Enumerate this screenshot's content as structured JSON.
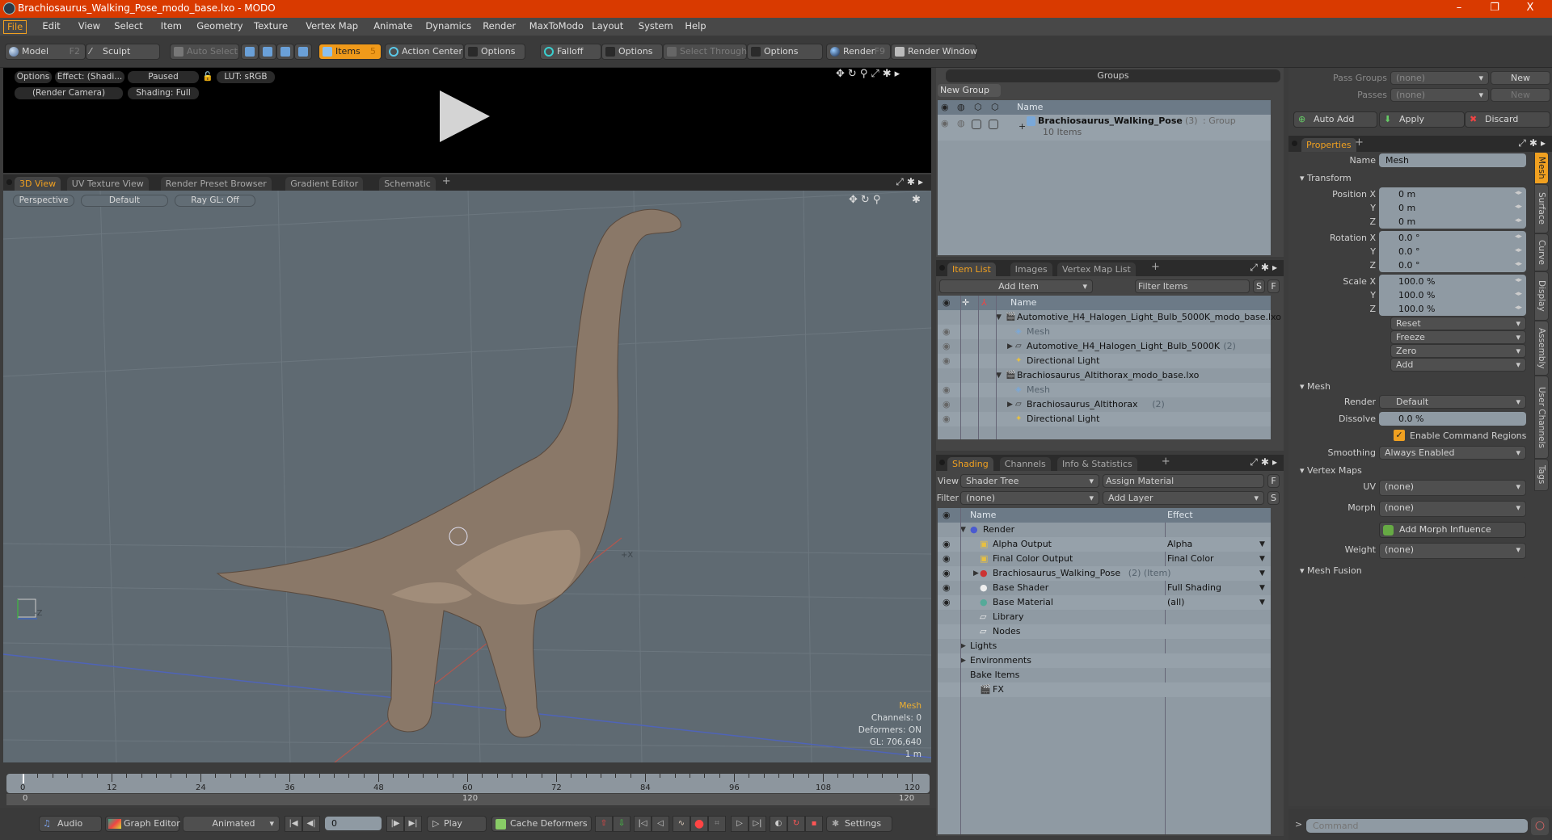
{
  "window": {
    "title": "Brachiosaurus_Walking_Pose_modo_base.lxo - MODO",
    "minimize": "–",
    "restore": "❐",
    "close": "X"
  },
  "menu": [
    "File",
    "Edit",
    "View",
    "Select",
    "Item",
    "Geometry",
    "Texture",
    "Vertex Map",
    "Animate",
    "Dynamics",
    "Render",
    "MaxToModo",
    "Layout",
    "System",
    "Help"
  ],
  "toolbar": {
    "model": "Model",
    "model_key": "F2",
    "sculpt": "Sculpt",
    "auto_select": "Auto Select",
    "items": "Items",
    "items_key": "5",
    "action_center": "Action Center",
    "options1": "Options",
    "falloff": "Falloff",
    "options2": "Options",
    "select_through": "Select Through",
    "options3": "Options",
    "render": "Render",
    "render_key": "F9",
    "render_window": "Render Window"
  },
  "preview": {
    "options": "Options",
    "effect": "Effect: (Shadi...",
    "paused": "Paused",
    "lut": "LUT: sRGB",
    "camera": "(Render Camera)",
    "shading": "Shading: Full"
  },
  "view_tabs": [
    "3D View",
    "UV Texture View",
    "Render Preset Browser",
    "Gradient Editor",
    "Schematic"
  ],
  "viewport": {
    "projection": "Perspective",
    "style": "Default",
    "raygl": "Ray GL: Off",
    "axis_neg_z": "-Z",
    "axis_pos_x": "+X",
    "stats": {
      "selection": "Mesh",
      "channels": "Channels: 0",
      "deformers": "Deformers: ON",
      "gl": "GL: 706,640",
      "scale": "1 m"
    },
    "accent": "#f0b030"
  },
  "timeline": {
    "ticks": [
      0,
      12,
      24,
      36,
      48,
      60,
      72,
      84,
      96,
      108,
      120
    ],
    "range_start": "0",
    "range_mid": "120",
    "range_end": "120"
  },
  "bottombar": {
    "audio": "Audio",
    "graph_editor": "Graph Editor",
    "animated": "Animated",
    "frame": "0",
    "play": "Play",
    "cache_deformers": "Cache Deformers",
    "settings": "Settings"
  },
  "groups": {
    "title": "Groups",
    "new_group": "New Group",
    "col_name": "Name",
    "item_name": "Brachiosaurus_Walking_Pose",
    "item_count": "(3)",
    "item_type": ": Group",
    "item_sub": "10 Items"
  },
  "itemlist": {
    "tabs": [
      "Item List",
      "Images",
      "Vertex Map List"
    ],
    "add_item": "Add Item",
    "filter": "Filter Items",
    "s": "S",
    "f": "F",
    "col_name": "Name",
    "rows": [
      {
        "name": "Automotive_H4_Halogen_Light_Bulb_5000K_modo_base.lxo",
        "count": "",
        "level": 0,
        "type": "scene",
        "eye": false,
        "dim": false
      },
      {
        "name": "Mesh",
        "count": "",
        "level": 1,
        "type": "mesh",
        "eye": true,
        "dim": true
      },
      {
        "name": "Automotive_H4_Halogen_Light_Bulb_5000K",
        "count": "(2)",
        "level": 1,
        "type": "group",
        "eye": true,
        "dim": false
      },
      {
        "name": "Directional Light",
        "count": "",
        "level": 1,
        "type": "light",
        "eye": true,
        "dim": false
      },
      {
        "name": "Brachiosaurus_Altithorax_modo_base.lxo",
        "count": "",
        "level": 0,
        "type": "scene",
        "eye": false,
        "dim": false
      },
      {
        "name": "Mesh",
        "count": "",
        "level": 1,
        "type": "mesh",
        "eye": true,
        "dim": true
      },
      {
        "name": "Brachiosaurus_Altithorax",
        "count": "(2)",
        "level": 1,
        "type": "group",
        "eye": true,
        "dim": false
      },
      {
        "name": "Directional Light",
        "count": "",
        "level": 1,
        "type": "light",
        "eye": true,
        "dim": false
      }
    ]
  },
  "shading": {
    "tabs": [
      "Shading",
      "Channels",
      "Info & Statistics"
    ],
    "view_label": "View",
    "view_value": "Shader Tree",
    "assign_material": "Assign Material",
    "f": "F",
    "filter_label": "Filter",
    "filter_value": "(none)",
    "add_layer": "Add Layer",
    "s": "S",
    "col_name": "Name",
    "col_effect": "Effect",
    "rows": [
      {
        "name": "Render",
        "extra": "",
        "effect": "",
        "level": 0,
        "eye": false,
        "icon": "render"
      },
      {
        "name": "Alpha Output",
        "extra": "",
        "effect": "Alpha",
        "level": 1,
        "eye": true,
        "icon": "output"
      },
      {
        "name": "Final Color Output",
        "extra": "",
        "effect": "Final Color",
        "level": 1,
        "eye": true,
        "icon": "output"
      },
      {
        "name": "Brachiosaurus_Walking_Pose",
        "extra": "(2) (Item)",
        "effect": "",
        "level": 1,
        "eye": true,
        "icon": "mask"
      },
      {
        "name": "Base Shader",
        "extra": "",
        "effect": "Full Shading",
        "level": 1,
        "eye": true,
        "icon": "shader"
      },
      {
        "name": "Base Material",
        "extra": "",
        "effect": "(all)",
        "level": 1,
        "eye": true,
        "icon": "material"
      },
      {
        "name": "Library",
        "extra": "",
        "effect": "",
        "level": 1,
        "eye": false,
        "icon": "folder"
      },
      {
        "name": "Nodes",
        "extra": "",
        "effect": "",
        "level": 1,
        "eye": false,
        "icon": "folder"
      },
      {
        "name": "Lights",
        "extra": "",
        "effect": "",
        "level": 0,
        "eye": false,
        "icon": "none"
      },
      {
        "name": "Environments",
        "extra": "",
        "effect": "",
        "level": 0,
        "eye": false,
        "icon": "none"
      },
      {
        "name": "Bake Items",
        "extra": "",
        "effect": "",
        "level": 0,
        "eye": false,
        "icon": "none"
      },
      {
        "name": "FX",
        "extra": "",
        "effect": "",
        "level": 1,
        "eye": false,
        "icon": "clapper"
      }
    ]
  },
  "passes": {
    "pass_groups": "Pass Groups",
    "passes": "Passes",
    "none": "(none)",
    "new": "New",
    "auto_add": "Auto Add",
    "apply": "Apply",
    "discard": "Discard"
  },
  "properties": {
    "tab": "Properties",
    "name_label": "Name",
    "name_value": "Mesh",
    "transform": "Transform",
    "position_label": "Position X",
    "rotation_label": "Rotation X",
    "scale_label": "Scale X",
    "y": "Y",
    "z": "Z",
    "position": [
      "0 m",
      "0 m",
      "0 m"
    ],
    "rotation": [
      "0.0 °",
      "0.0 °",
      "0.0 °"
    ],
    "scale": [
      "100.0 %",
      "100.0 %",
      "100.0 %"
    ],
    "actions": [
      "Reset",
      "Freeze",
      "Zero",
      "Add"
    ],
    "mesh": "Mesh",
    "render_label": "Render",
    "render_value": "Default",
    "dissolve_label": "Dissolve",
    "dissolve_value": "0.0 %",
    "enable_cmd": "Enable Command Regions",
    "smoothing_label": "Smoothing",
    "smoothing_value": "Always Enabled",
    "vertex_maps": "Vertex Maps",
    "uv_label": "UV",
    "uv_value": "(none)",
    "morph_label": "Morph",
    "morph_value": "(none)",
    "add_morph": "Add Morph Influence",
    "weight_label": "Weight",
    "weight_value": "(none)",
    "mesh_fusion": "Mesh Fusion",
    "side_tabs": [
      "Mesh",
      "Surface",
      "Curve",
      "Display",
      "Assembly",
      "User Channels",
      "Tags"
    ]
  },
  "command": {
    "prompt": ">",
    "placeholder": "Command"
  }
}
